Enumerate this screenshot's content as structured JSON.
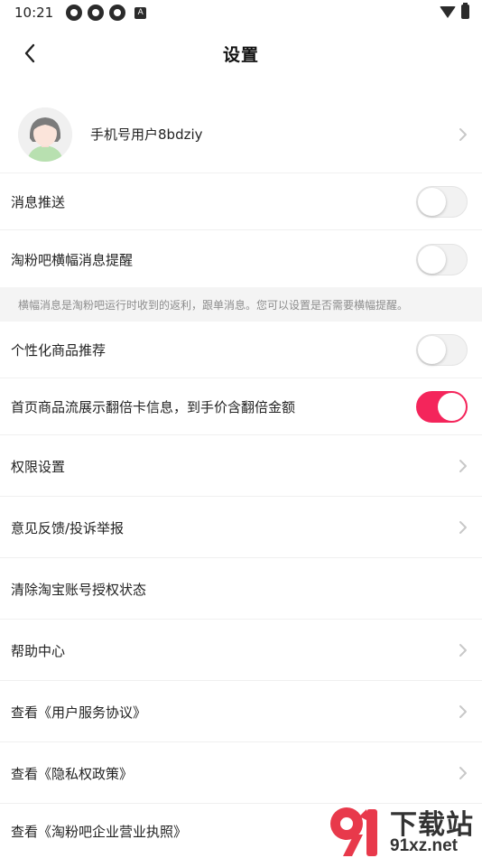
{
  "status_bar": {
    "time": "10:21",
    "left_icons": [
      "app-icon",
      "app-icon",
      "app-icon",
      "a-icon"
    ],
    "a_icon_letter": "A",
    "right_icons": [
      "wifi-icon",
      "battery-icon"
    ]
  },
  "header": {
    "title": "设置"
  },
  "profile": {
    "name": "手机号用户8bdziy"
  },
  "settings": {
    "push": {
      "label": "消息推送",
      "on": false
    },
    "banner": {
      "label": "淘粉吧横幅消息提醒",
      "on": false
    },
    "banner_hint": "横幅消息是淘粉吧运行时收到的返利，跟单消息。您可以设置是否需要横幅提醒。",
    "personalized": {
      "label": "个性化商品推荐",
      "on": false
    },
    "double_card": {
      "label": "首页商品流展示翻倍卡信息，到手价含翻倍金额",
      "on": true
    },
    "permissions": "权限设置",
    "feedback": "意见反馈/投诉举报",
    "clear_taobao": "清除淘宝账号授权状态",
    "help": "帮助中心",
    "user_agreement": "查看《用户服务协议》",
    "privacy": "查看《隐私权政策》",
    "license": "查看《淘粉吧企业营业执照》"
  },
  "colors": {
    "toggle_on": "#f4255b",
    "toggle_off": "#f2f2f2",
    "hint_band": "#f4f4f4"
  },
  "watermark": {
    "title": "下载站",
    "url": "91xz.net"
  }
}
